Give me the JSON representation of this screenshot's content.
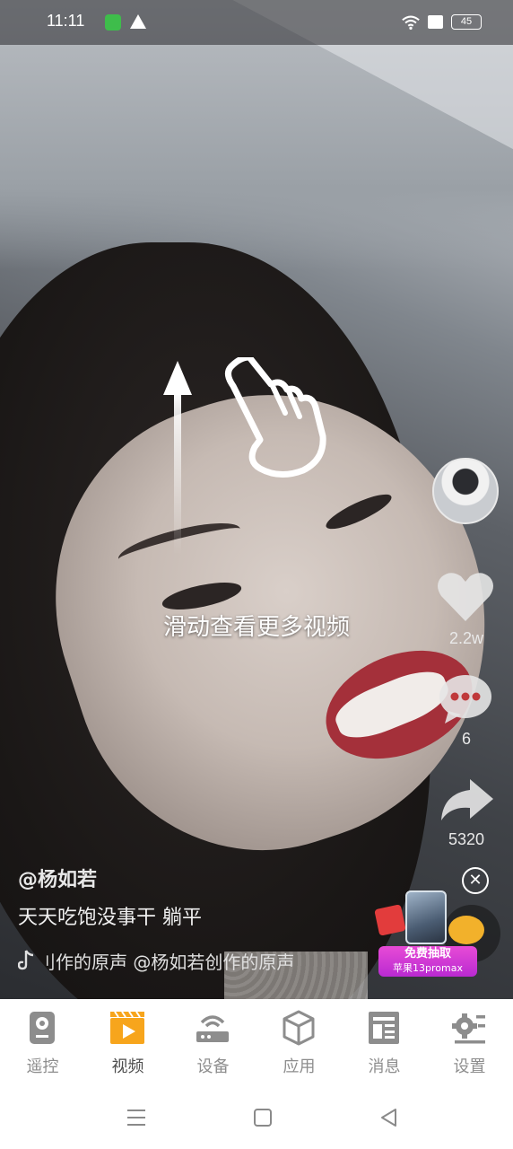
{
  "status_bar": {
    "time": "11:11",
    "battery": "45",
    "icons": [
      "app-notification-icon",
      "warning-icon",
      "wifi-icon",
      "no-sim-icon",
      "battery-icon"
    ]
  },
  "video": {
    "swipe_hint": "滑动查看更多视频",
    "author": "@杨如若",
    "description": "天天吃饱没事干 躺平",
    "music": "刂作的原声    @杨如若创作的原声",
    "likes": "2.2w",
    "comments": "6",
    "shares": "5320"
  },
  "ad": {
    "line1": "免费抽取",
    "line2": "苹果13promax"
  },
  "tabs": [
    {
      "label": "遥控",
      "icon": "remote-icon",
      "active": false
    },
    {
      "label": "视频",
      "icon": "video-icon",
      "active": true
    },
    {
      "label": "设备",
      "icon": "router-icon",
      "active": false
    },
    {
      "label": "应用",
      "icon": "cube-icon",
      "active": false
    },
    {
      "label": "消息",
      "icon": "message-icon",
      "active": false
    },
    {
      "label": "设置",
      "icon": "settings-icon",
      "active": false
    }
  ],
  "colors": {
    "accent": "#f7a51c",
    "tab_inactive": "#8d8d8d"
  }
}
